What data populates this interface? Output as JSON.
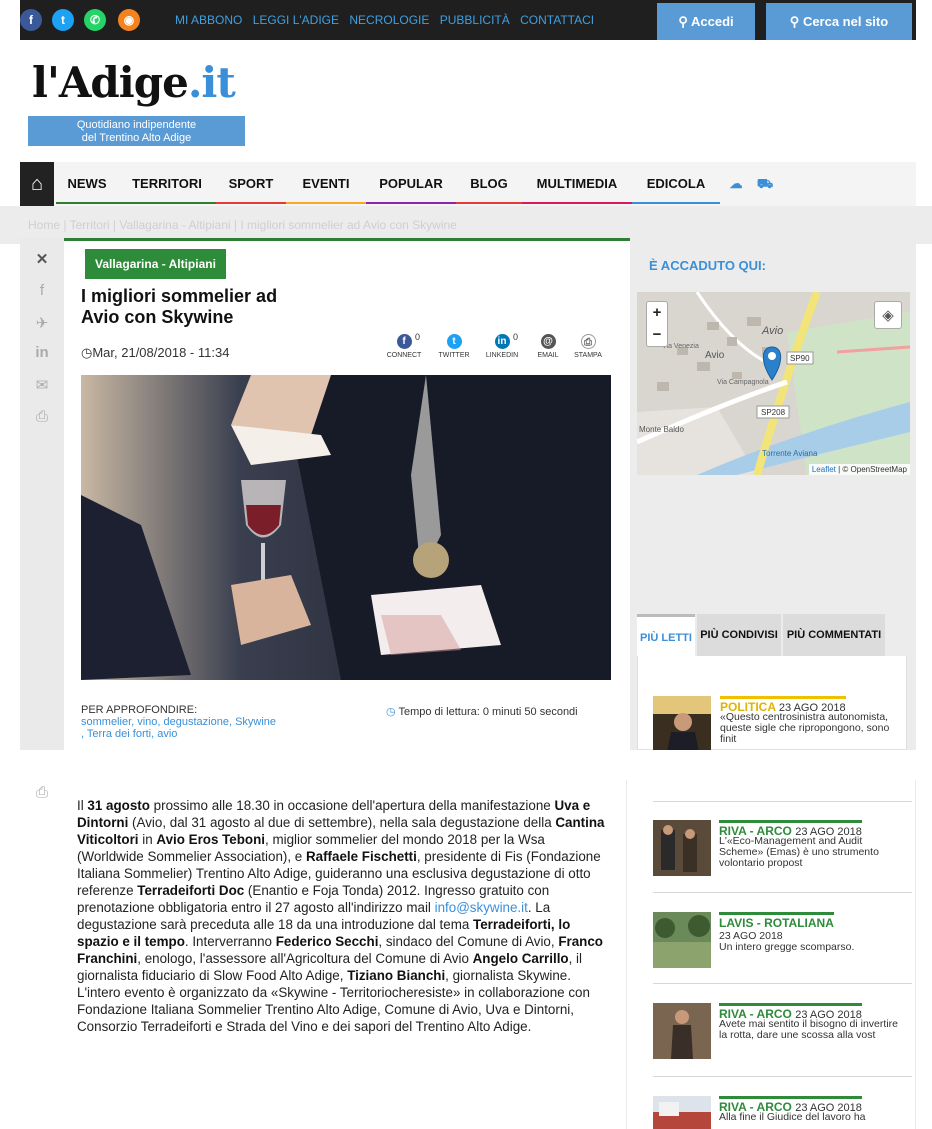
{
  "topbar": {
    "social": [
      "f",
      "t",
      "w",
      "rss"
    ],
    "links": [
      "MI ABBONO",
      "LEGGI L'ADIGE",
      "NECROLOGIE",
      "PUBBLICITÀ",
      "CONTATTACI"
    ],
    "login_label": "Accedi",
    "search_label": "Cerca nel sito"
  },
  "masthead": {
    "logo_main": "l'Adige",
    "logo_ext": ".it",
    "tagline_1": "Quotidiano indipendente",
    "tagline_2": "del Trentino Alto Adige"
  },
  "nav": {
    "items": [
      {
        "label": "NEWS",
        "color": "#2e7d32"
      },
      {
        "label": "TERRITORI",
        "color": "#2e7d32"
      },
      {
        "label": "SPORT",
        "color": "#e53935"
      },
      {
        "label": "EVENTI",
        "color": "#f9a825"
      },
      {
        "label": "POPULAR",
        "color": "#8e24aa"
      },
      {
        "label": "BLOG",
        "color": "#e53935"
      },
      {
        "label": "MULTIMEDIA",
        "color": "#d81b60"
      },
      {
        "label": "EDICOLA",
        "color": "#3a8fd8"
      }
    ]
  },
  "breadcrumb": "Home  |  Territori  |  Vallagarina - Altipiani  |  I migliori sommelier ad Avio con Skywine",
  "article": {
    "category": "Vallagarina - Altipiani",
    "title": "I migliori sommelier ad Avio con Skywine",
    "date": "Mar, 21/08/2018 - 11:34",
    "share": [
      {
        "label": "CONNECT",
        "count": "0",
        "glyph": "f",
        "color": "#3b5998"
      },
      {
        "label": "TWITTER",
        "count": "",
        "glyph": "t",
        "color": "#1da1f2"
      },
      {
        "label": "LINKEDIN",
        "count": "0",
        "glyph": "in",
        "color": "#0077b5"
      },
      {
        "label": "EMAIL",
        "count": "",
        "glyph": "@",
        "color": "#555555"
      },
      {
        "label": "STAMPA",
        "count": "",
        "glyph": "⎙",
        "color": "#777777"
      }
    ],
    "approfondire_label": "PER APPROFONDIRE:",
    "tags_line1": "sommelier, vino, degustazione, Skywine",
    "tags_line2": ", Terra dei forti, avio",
    "read_time": "Tempo di lettura: 0 minuti 50 secondi"
  },
  "sidebar": {
    "accaduto": "È ACCADUTO QUI:",
    "map": {
      "attribution_leaflet": "Leaflet",
      "attribution_rest": " | © OpenStreetMap",
      "labels": [
        "Avio",
        "Avio",
        "SP90",
        "SP208",
        "Monte Baldo",
        "Torrente Aviana",
        "Via Venezia",
        "Via Campagnola"
      ]
    },
    "tabs": [
      "PIÙ LETTI",
      "PIÙ CONDIVISI",
      "PIÙ COMMENTATI"
    ],
    "news": [
      {
        "category": "POLITICA",
        "date": "23 AGO 2018",
        "text": "«Questo centrosinistra autonomista, queste sigle che ripropongono, sono finit"
      },
      {
        "category": "RIVA - ARCO",
        "date": "23 AGO 2018",
        "text": "L'«Eco-Management and Audit Scheme» (Emas) è uno strumento volontario propost"
      },
      {
        "category": "LAVIS - ROTALIANA",
        "date": "23 AGO 2018",
        "text": "Un intero gregge scomparso."
      },
      {
        "category": "RIVA - ARCO",
        "date": "23 AGO 2018",
        "text": "Avete mai sentito il bisogno di invertire la rotta, dare une scossa alla vost"
      },
      {
        "category": "RIVA - ARCO",
        "date": "23 AGO 2018",
        "text": "Alla fine il Giudice del lavoro ha"
      }
    ]
  },
  "body": {
    "p1": "Il ",
    "b1": "31 agosto",
    "p2": " prossimo alle 18.30 in occasione dell'apertura della manifestazione ",
    "b2": "Uva e Dintorni",
    "p3": " (Avio, dal 31 agosto al due di settembre), nella sala degustazione della ",
    "b3": "Cantina Viticoltori",
    "p4": " in ",
    "b4": "Avio Eros Teboni",
    "p5": ", miglior sommelier del mondo 2018 per la Wsa (Worldwide Sommelier Association), e ",
    "b5": "Raffaele Fischetti",
    "p6": ", presidente di Fis (Fondazione Italiana Sommelier) Trentino Alto Adige, guideranno una esclusiva degustazione di otto referenze ",
    "b6": "Terradeiforti Doc",
    "p7": " (Enantio e Foja Tonda) 2012. Ingresso gratuito con prenotazione obbligatoria entro il 27 agosto all'indirizzo mail ",
    "mail": "info@skywine.it",
    "p8": ". La degustazione sarà preceduta alle 18 da una introduzione dal tema ",
    "b7": "Terradeiforti, lo spazio e il tempo",
    "p9": ". Interverranno ",
    "b8": "Federico Secchi",
    "p10": ", sindaco del Comune di Avio, ",
    "b9": "Franco Franchini",
    "p11": ", enologo, l'assessore all'Agricoltura del Comune di Avio ",
    "b10": "Angelo Carrillo",
    "p12": ", il giornalista fiduciario di Slow Food Alto Adige, ",
    "b11": "Tiziano Bianchi",
    "p13": ", giornalista Skywine. L'intero evento è organizzato da «Skywine - Territoriocheresiste» in collaborazione con Fondazione Italiana Sommelier Trentino Alto Adige, Comune di Avio, Uva e Dintorni, Consorzio Terradeiforti e Strada del Vino e dei sapori del Trentino Alto Adige."
  }
}
